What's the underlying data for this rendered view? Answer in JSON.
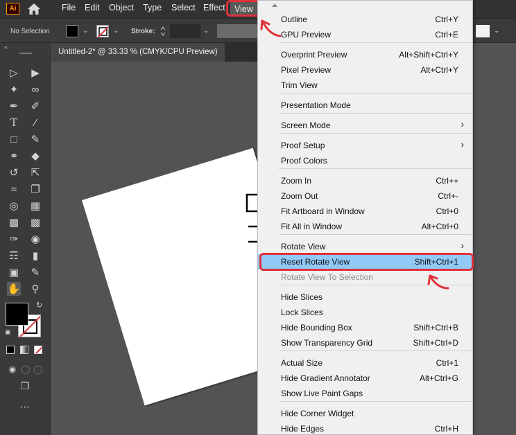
{
  "menubar": {
    "logo": "Ai",
    "items": [
      "File",
      "Edit",
      "Object",
      "Type",
      "Select",
      "Effect",
      "View"
    ]
  },
  "control": {
    "selection": "No Selection",
    "stroke_label": "Stroke:"
  },
  "tab": {
    "title": "Untitled-2* @ 33.33 % (CMYK/CPU Preview)"
  },
  "colors": {
    "highlight_red": "#e0313a",
    "menu_selected": "#91c9f7"
  },
  "view_menu": {
    "rows": [
      {
        "label": "Outline",
        "shortcut": "Ctrl+Y"
      },
      {
        "label": "GPU Preview",
        "shortcut": "Ctrl+E"
      },
      {
        "label": "Overprint Preview",
        "shortcut": "Alt+Shift+Ctrl+Y"
      },
      {
        "label": "Pixel Preview",
        "shortcut": "Alt+Ctrl+Y"
      },
      {
        "label": "Trim View",
        "shortcut": ""
      },
      {
        "label": "Presentation Mode",
        "shortcut": ""
      },
      {
        "label": "Screen Mode",
        "shortcut": "",
        "submenu": true
      },
      {
        "label": "Proof Setup",
        "shortcut": "",
        "submenu": true
      },
      {
        "label": "Proof Colors",
        "shortcut": ""
      },
      {
        "label": "Zoom In",
        "shortcut": "Ctrl++"
      },
      {
        "label": "Zoom Out",
        "shortcut": "Ctrl+-"
      },
      {
        "label": "Fit Artboard in Window",
        "shortcut": "Ctrl+0"
      },
      {
        "label": "Fit All in Window",
        "shortcut": "Alt+Ctrl+0"
      },
      {
        "label": "Rotate View",
        "shortcut": "",
        "submenu": true
      },
      {
        "label": "Reset Rotate View",
        "shortcut": "Shift+Ctrl+1",
        "highlighted": true
      },
      {
        "label": "Rotate View To Selection",
        "shortcut": "",
        "disabled": true
      },
      {
        "label": "Hide Slices",
        "shortcut": ""
      },
      {
        "label": "Lock Slices",
        "shortcut": ""
      },
      {
        "label": "Hide Bounding Box",
        "shortcut": "Shift+Ctrl+B"
      },
      {
        "label": "Show Transparency Grid",
        "shortcut": "Shift+Ctrl+D"
      },
      {
        "label": "Actual Size",
        "shortcut": "Ctrl+1"
      },
      {
        "label": "Hide Gradient Annotator",
        "shortcut": "Alt+Ctrl+G"
      },
      {
        "label": "Show Live Paint Gaps",
        "shortcut": ""
      },
      {
        "label": "Hide Corner Widget",
        "shortcut": ""
      },
      {
        "label": "Hide Edges",
        "shortcut": "Ctrl+H"
      }
    ]
  }
}
